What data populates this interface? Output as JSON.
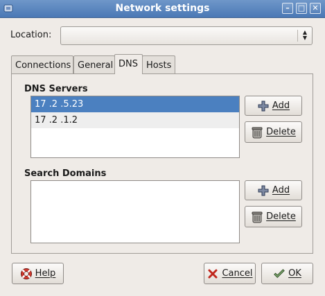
{
  "window": {
    "title": "Network settings",
    "menu_icon": "window-menu-icon",
    "buttons": [
      "minimize-icon",
      "maximize-icon",
      "close-icon"
    ]
  },
  "location": {
    "label": "Location:",
    "value": ""
  },
  "tabs": [
    {
      "label": "Connections"
    },
    {
      "label": "General"
    },
    {
      "label": "DNS",
      "active": true
    },
    {
      "label": "Hosts"
    }
  ],
  "dns_servers": {
    "title": "DNS Servers",
    "entries": [
      "17 .2 .5.23",
      "17 .2 .1.2"
    ],
    "add_label": "Add",
    "delete_label": "Delete"
  },
  "search_domains": {
    "title": "Search Domains",
    "entries": [],
    "add_label": "Add",
    "delete_label": "Delete"
  },
  "footer": {
    "help_label": "Help",
    "cancel_label": "Cancel",
    "ok_label": "OK"
  },
  "colors": {
    "titlebar": "#4a78b5",
    "selection": "#4b80c0",
    "background": "#efebe7"
  }
}
